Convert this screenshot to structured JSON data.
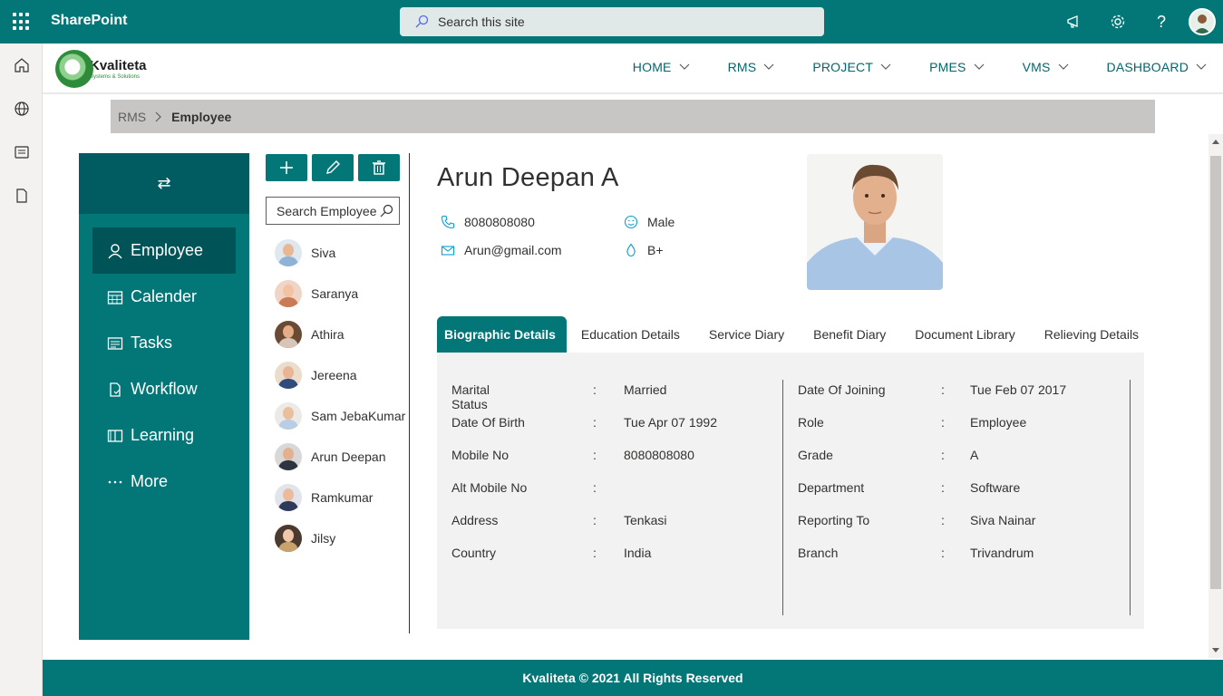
{
  "suitebar": {
    "app_name": "SharePoint",
    "search_placeholder": "Search this site",
    "icons": [
      "waffle-icon",
      "megaphone-icon",
      "gear-icon",
      "help-icon",
      "user-avatar"
    ],
    "help_glyph": "?"
  },
  "appbar": {
    "icons": [
      "home-icon",
      "globe-icon",
      "news-icon",
      "file-icon"
    ]
  },
  "site": {
    "logo_name": "Kvaliteta",
    "logo_tagline": "Systems & Solutions",
    "nav": [
      {
        "label": "HOME"
      },
      {
        "label": "RMS"
      },
      {
        "label": "PROJECT"
      },
      {
        "label": "PMES"
      },
      {
        "label": "VMS"
      },
      {
        "label": "DASHBOARD"
      }
    ]
  },
  "breadcrumb": {
    "parent": "RMS",
    "current": "Employee"
  },
  "sidemenu": {
    "toggle_glyph": "⇄",
    "items": [
      {
        "label": "Employee",
        "icon": "person-icon",
        "active": true
      },
      {
        "label": "Calender",
        "icon": "calendar-icon"
      },
      {
        "label": "Tasks",
        "icon": "tasks-icon"
      },
      {
        "label": "Workflow",
        "icon": "workflow-icon"
      },
      {
        "label": "Learning",
        "icon": "book-icon"
      },
      {
        "label": "More",
        "icon": "more-icon"
      }
    ]
  },
  "employee_list": {
    "search_placeholder": "Search Employee",
    "toolbar": [
      "add-icon",
      "edit-icon",
      "delete-icon"
    ],
    "employees": [
      {
        "name": "Siva"
      },
      {
        "name": "Saranya"
      },
      {
        "name": "Athira"
      },
      {
        "name": "Jereena"
      },
      {
        "name": "Sam JebaKumar"
      },
      {
        "name": "Arun Deepan"
      },
      {
        "name": "Ramkumar"
      },
      {
        "name": "Jilsy"
      }
    ]
  },
  "profile": {
    "name": "Arun Deepan A",
    "phone": "8080808080",
    "email": "Arun@gmail.com",
    "gender": "Male",
    "blood_group": "B+"
  },
  "tabs": [
    {
      "label": "Biographic Details",
      "active": true
    },
    {
      "label": "Education Details"
    },
    {
      "label": "Service Diary"
    },
    {
      "label": "Benefit Diary"
    },
    {
      "label": "Document Library"
    },
    {
      "label": "Relieving Details"
    }
  ],
  "details": {
    "separator": ":",
    "left": [
      {
        "label": "Marital Status",
        "value": "Married"
      },
      {
        "label": "Date Of Birth",
        "value": "Tue Apr 07 1992"
      },
      {
        "label": "Mobile No",
        "value": "8080808080"
      },
      {
        "label": "Alt Mobile No",
        "value": ""
      },
      {
        "label": "Address",
        "value": "Tenkasi"
      },
      {
        "label": "Country",
        "value": "India"
      }
    ],
    "right": [
      {
        "label": "Date Of Joining",
        "value": "Tue Feb 07 2017"
      },
      {
        "label": "Role",
        "value": "Employee"
      },
      {
        "label": "Grade",
        "value": "A"
      },
      {
        "label": "Department",
        "value": "Software"
      },
      {
        "label": "Reporting To",
        "value": "Siva Nainar"
      },
      {
        "label": "Branch",
        "value": "Trivandrum"
      }
    ]
  },
  "footer": {
    "text": "Kvaliteta © 2021 All Rights Reserved"
  },
  "colors": {
    "brand_teal": "#037677",
    "brand_teal_dark": "#005356",
    "panel_gray": "#f2f2f2",
    "breadcrumb_gray": "#c8c6c4"
  }
}
